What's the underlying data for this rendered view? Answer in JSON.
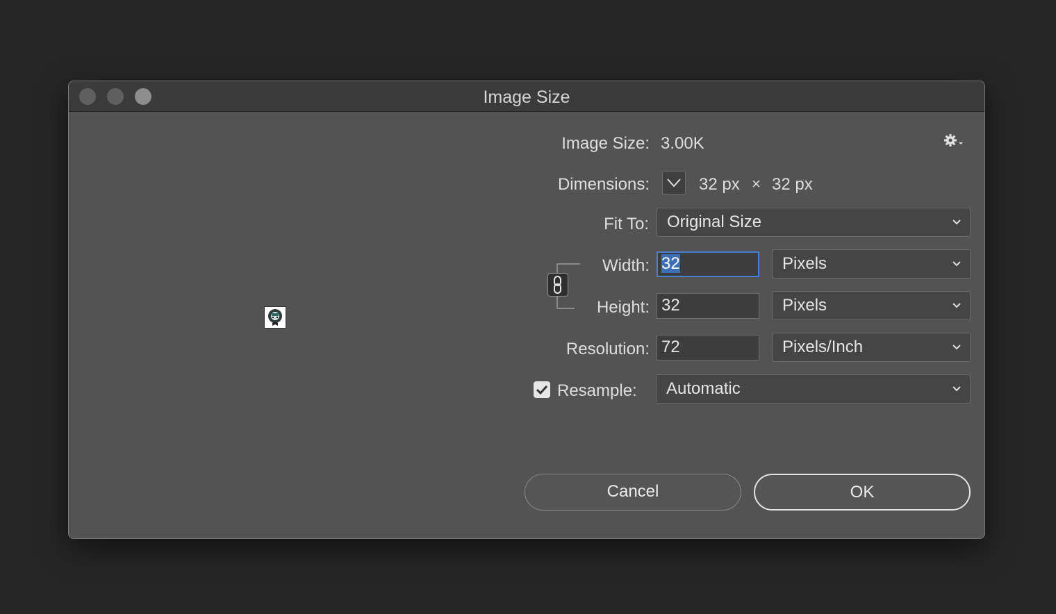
{
  "window": {
    "title": "Image Size"
  },
  "info": {
    "image_size_label": "Image Size:",
    "image_size_value": "3.00K",
    "dimensions_label": "Dimensions:",
    "dim_width": "32 px",
    "dim_times": "×",
    "dim_height": "32 px"
  },
  "fit_to": {
    "label": "Fit To:",
    "value": "Original Size"
  },
  "width": {
    "label": "Width:",
    "value": "32",
    "unit": "Pixels"
  },
  "height": {
    "label": "Height:",
    "value": "32",
    "unit": "Pixels"
  },
  "resolution": {
    "label": "Resolution:",
    "value": "72",
    "unit": "Pixels/Inch"
  },
  "resample": {
    "label": "Resample:",
    "checked": true,
    "value": "Automatic"
  },
  "buttons": {
    "cancel": "Cancel",
    "ok": "OK"
  },
  "icons": [
    "gear-icon",
    "chevron-down-icon",
    "link-icon",
    "checkmark-icon"
  ],
  "colors": {
    "dialog_bg": "#535353",
    "titlebar_bg": "#3b3b3b",
    "focus_ring": "#4a7fd6",
    "selection": "#3d6fb6"
  }
}
